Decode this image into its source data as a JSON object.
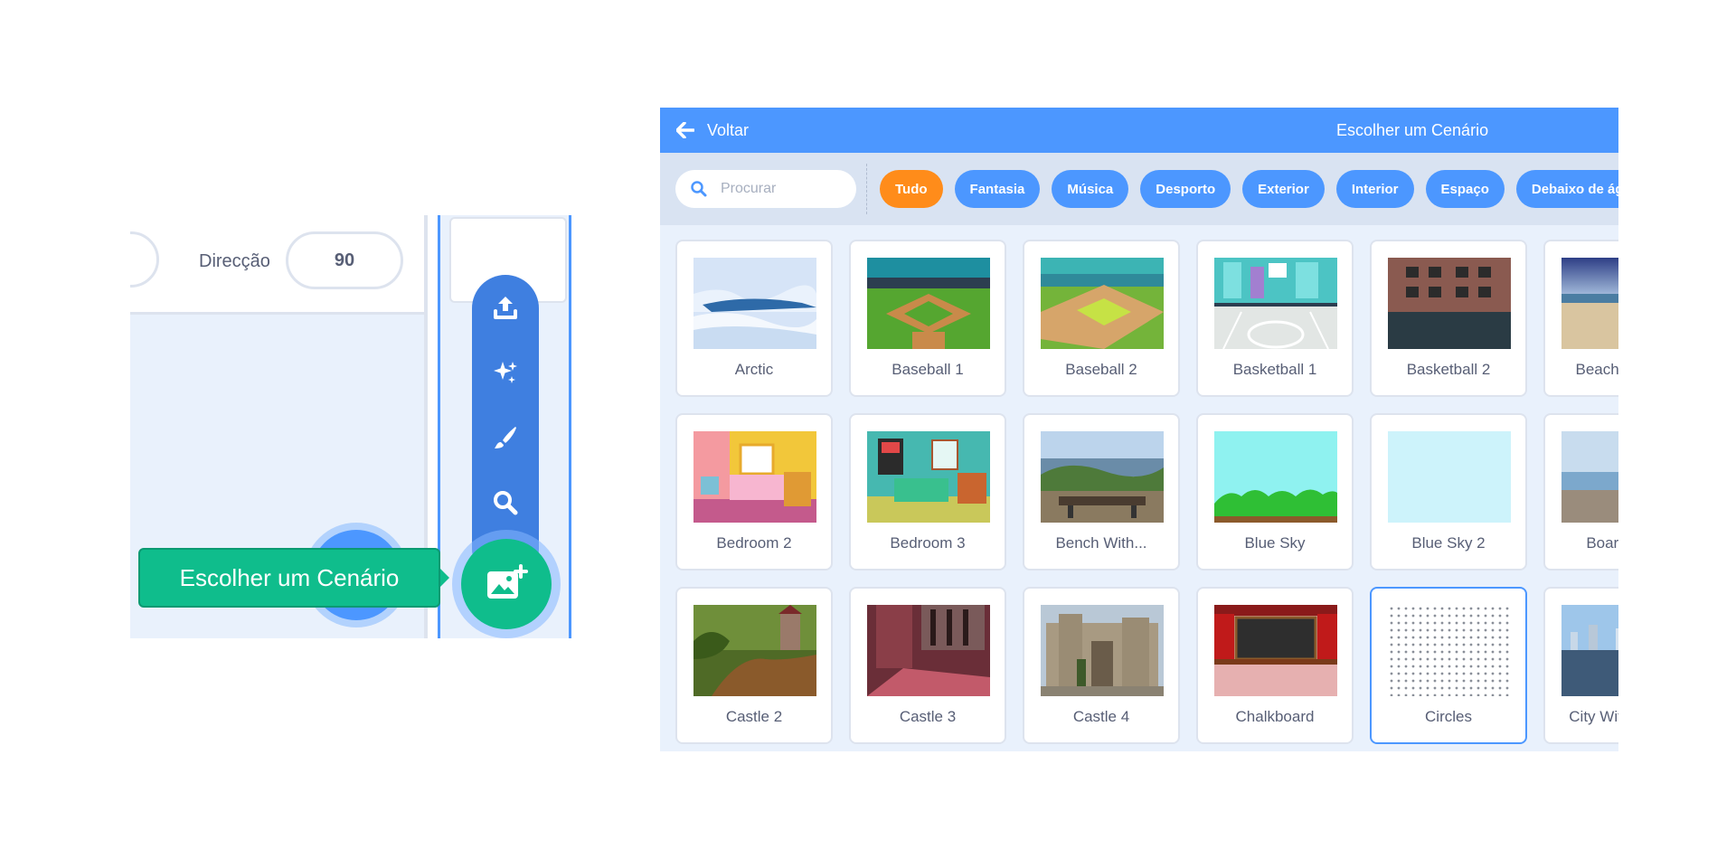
{
  "left_panel": {
    "direction_label": "Direcção",
    "direction_value": "90",
    "tooltip": "Escolher um Cenário",
    "menu_icons": [
      "upload-icon",
      "surprise-icon",
      "paint-icon",
      "search-icon"
    ],
    "main_button_icon": "backdrop-add-icon"
  },
  "library": {
    "back_label": "Voltar",
    "title": "Escolher um Cenário",
    "search_placeholder": "Procurar",
    "tags": [
      "Tudo",
      "Fantasia",
      "Música",
      "Desporto",
      "Exterior",
      "Interior",
      "Espaço",
      "Debaixo de água"
    ],
    "active_tag": "Tudo",
    "items": [
      {
        "name": "Arctic"
      },
      {
        "name": "Baseball 1"
      },
      {
        "name": "Baseball 2"
      },
      {
        "name": "Basketball 1"
      },
      {
        "name": "Basketball 2"
      },
      {
        "name": "Beach Malibu"
      },
      {
        "name": "Bedroom 2"
      },
      {
        "name": "Bedroom 3"
      },
      {
        "name": "Bench With..."
      },
      {
        "name": "Blue Sky"
      },
      {
        "name": "Blue Sky 2"
      },
      {
        "name": "Boardwalk"
      },
      {
        "name": "Castle 2"
      },
      {
        "name": "Castle 3"
      },
      {
        "name": "Castle 4"
      },
      {
        "name": "Chalkboard"
      },
      {
        "name": "Circles"
      },
      {
        "name": "City With Water"
      }
    ],
    "selected_item": "Circles",
    "colors": {
      "header": "#4c97ff",
      "active_tag": "#ff8c1a",
      "tooltip": "#0fbd8c"
    }
  }
}
